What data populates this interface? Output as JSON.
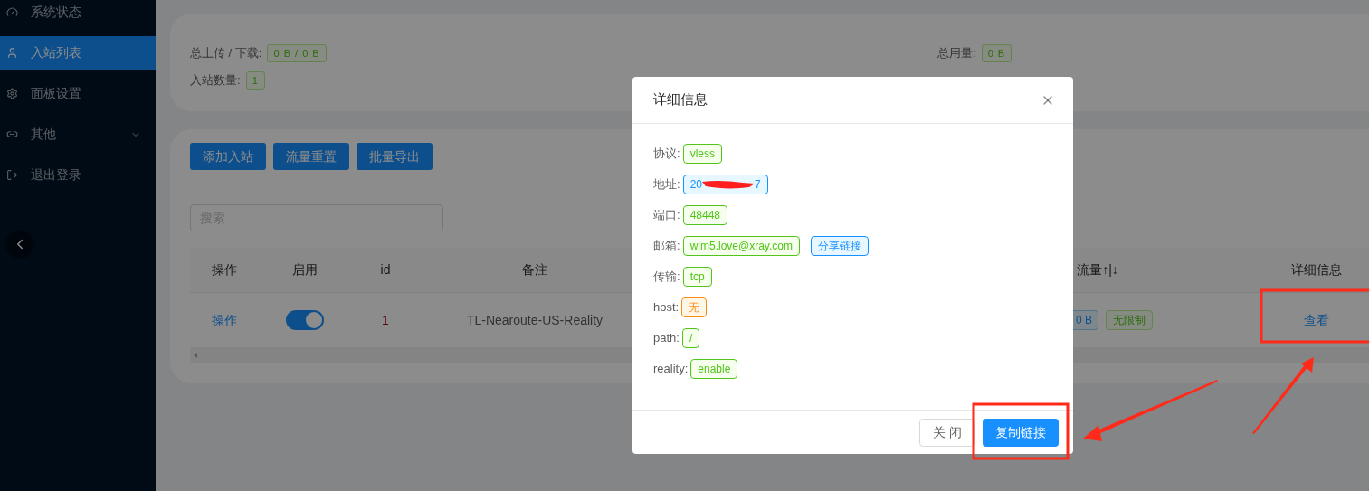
{
  "sidebar": {
    "items": [
      {
        "label": "系统状态",
        "kind": "link",
        "selected": false
      },
      {
        "label": "入站列表",
        "kind": "link",
        "selected": true
      },
      {
        "label": "面板设置",
        "kind": "link",
        "selected": false
      },
      {
        "label": "其他",
        "kind": "submenu",
        "selected": false
      },
      {
        "label": "退出登录",
        "kind": "link",
        "selected": false
      }
    ]
  },
  "stats": {
    "rows": [
      [
        {
          "label": "总上传 / 下载:",
          "value": "0 B / 0 B"
        },
        {
          "label": "总用量:",
          "value": "0 B"
        }
      ],
      [
        {
          "label": "入站数量:",
          "value": "1"
        }
      ]
    ]
  },
  "toolbar": {
    "buttons": [
      "添加入站",
      "流量重置",
      "批量导出"
    ]
  },
  "search": {
    "placeholder": "搜索"
  },
  "table": {
    "columns": [
      "操作",
      "启用",
      "id",
      "备注",
      "流量↑|↓",
      "详细信息"
    ],
    "rows": [
      {
        "action": "操作",
        "enabled": true,
        "id": "1",
        "remark": "TL-Nearoute-US-Reality",
        "traffic": "0 B",
        "limit": "无限制",
        "details": "查看"
      }
    ]
  },
  "modal": {
    "title": "详细信息",
    "fields": [
      {
        "label": "协议:",
        "tags": [
          {
            "kind": "text",
            "text": "vless",
            "color": "#52c41a"
          }
        ]
      },
      {
        "label": "地址:",
        "tags": [
          {
            "kind": "redacted",
            "text_start": "20",
            "text_end": "7",
            "color": "#1890ff"
          }
        ]
      },
      {
        "label": "端口:",
        "tags": [
          {
            "kind": "text",
            "text": "48448",
            "color": "#52c41a"
          }
        ]
      },
      {
        "label": "邮箱:",
        "tags": [
          {
            "kind": "text",
            "text": "wlm5.love@xray.com",
            "color": "#52c41a"
          },
          {
            "kind": "link",
            "text": "分享链接",
            "color": "#1890ff"
          }
        ]
      },
      {
        "label": "传输:",
        "tags": [
          {
            "kind": "text",
            "text": "tcp",
            "color": "#52c41a"
          }
        ]
      },
      {
        "label": "host:",
        "tags": [
          {
            "kind": "text",
            "text": "无",
            "color": "#fa8c16"
          }
        ]
      },
      {
        "label": "path:",
        "tags": [
          {
            "kind": "text",
            "text": "/",
            "color": "#52c41a"
          }
        ]
      },
      {
        "label": "reality:",
        "tags": [
          {
            "kind": "text",
            "text": "enable",
            "color": "#52c41a"
          }
        ]
      }
    ],
    "buttons": [
      {
        "label": "关 闭",
        "kind": "default"
      },
      {
        "label": "复制链接",
        "kind": "primary"
      }
    ]
  }
}
